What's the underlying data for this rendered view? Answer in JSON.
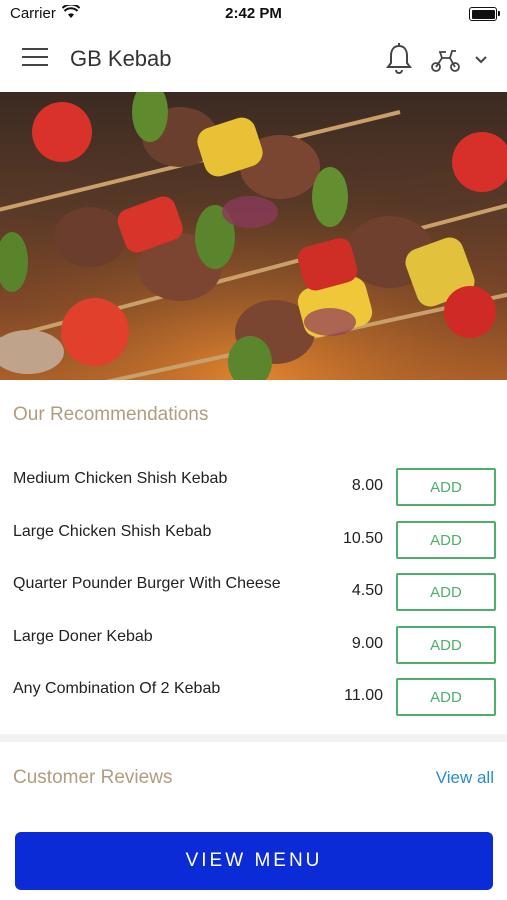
{
  "status_bar": {
    "carrier": "Carrier",
    "time": "2:42 PM"
  },
  "header": {
    "title": "GB Kebab"
  },
  "icons": {
    "menu": "menu-icon",
    "bell": "bell-icon",
    "delivery": "scooter-icon",
    "chevron": "chevron-down-icon"
  },
  "recommendations": {
    "title": "Our Recommendations",
    "add_label": "ADD",
    "items": [
      {
        "name": "Medium Chicken Shish Kebab",
        "price": "8.00"
      },
      {
        "name": "Large Chicken Shish Kebab",
        "price": "10.50"
      },
      {
        "name": "Quarter Pounder Burger With Cheese",
        "price": "4.50"
      },
      {
        "name": "Large Doner Kebab",
        "price": "9.00"
      },
      {
        "name": "Any Combination Of 2 Kebab",
        "price": "11.00"
      }
    ]
  },
  "reviews": {
    "title": "Customer Reviews",
    "view_all": "View all"
  },
  "cta": {
    "label": "VIEW MENU"
  },
  "colors": {
    "accent_green": "#4caf6c",
    "cta_blue": "#0b2bd6",
    "section_title": "#b19d80",
    "link": "#2a8ec6"
  }
}
